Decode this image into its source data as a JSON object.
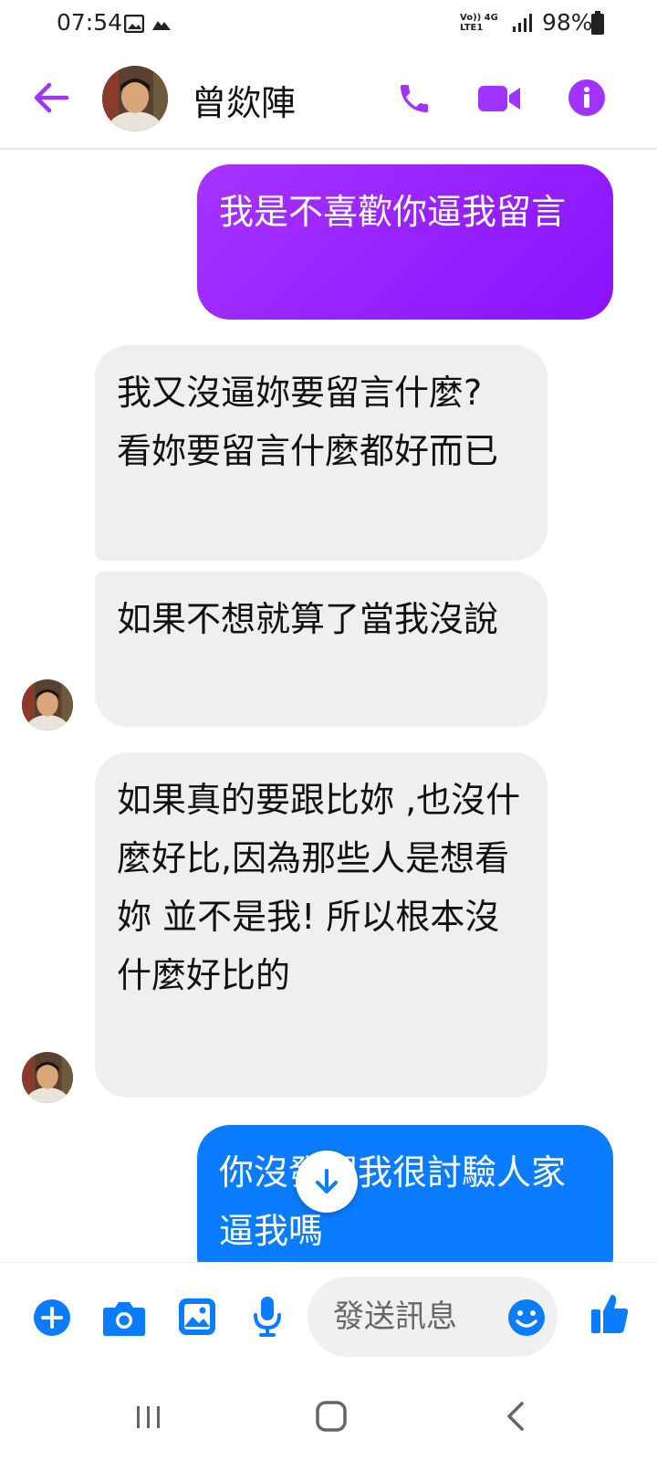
{
  "status_bar": {
    "time": "07:54",
    "network_label_top": "Vo)) 4G",
    "network_label_bottom": "LTE1",
    "battery": "98%"
  },
  "header": {
    "contact_name": "曾欻陣",
    "icons": [
      "back-arrow-icon",
      "phone-icon",
      "video-call-icon",
      "info-icon"
    ],
    "accent_color": "#a033ff"
  },
  "messages": [
    {
      "side": "outgoing",
      "text": "我是不喜歡你逼我留言",
      "color": "#9b1bff"
    },
    {
      "side": "incoming",
      "text": "我又沒逼妳要留言什麼? 看妳要留言什麼都好而已"
    },
    {
      "side": "incoming",
      "text": "如果不想就算了當我沒說"
    },
    {
      "side": "incoming",
      "text": "如果真的要跟比妳 ,也沒什麼好比,因為那些人是想看妳 並不是我! 所以根本沒什麼好比的"
    },
    {
      "side": "outgoing",
      "text": "你沒發現我很討驗人家逼我嗎",
      "color": "#0a7cff"
    }
  ],
  "composer": {
    "placeholder": "發送訊息",
    "icons": [
      "plus-icon",
      "camera-icon",
      "gallery-icon",
      "microphone-icon",
      "emoji-icon",
      "thumbs-up-icon"
    ],
    "accent_color": "#0a7cff"
  },
  "nav_bar": {
    "icons": [
      "recent-apps-icon",
      "home-icon",
      "back-icon"
    ]
  }
}
